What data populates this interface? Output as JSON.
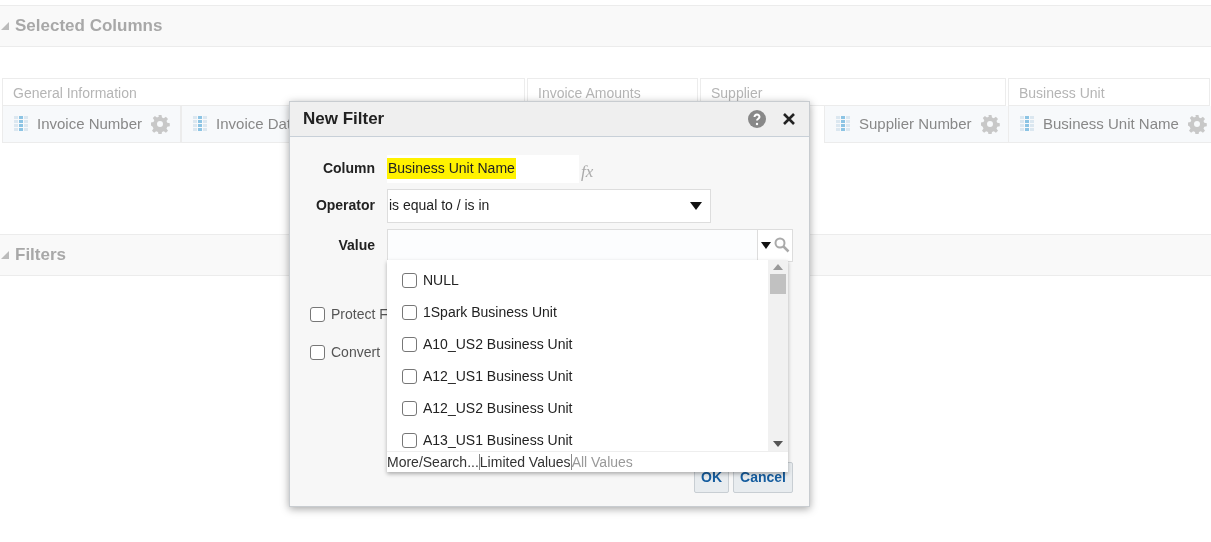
{
  "sections": [
    {
      "title": "Selected Columns",
      "expanded": true
    },
    {
      "title": "Filters",
      "expanded": true
    }
  ],
  "column_groups": [
    {
      "title": "General Information",
      "columns": [
        "Invoice Number",
        "Invoice Dat"
      ]
    },
    {
      "title": "Invoice Amounts"
    },
    {
      "title": "Supplier",
      "columns": [
        "Supplier Number"
      ]
    },
    {
      "title": "Business Unit",
      "columns": [
        "Business Unit Name"
      ]
    }
  ],
  "dialog": {
    "title": "New Filter",
    "column": {
      "label": "Column",
      "value": "Business Unit Name",
      "highlighted": true,
      "formula_button": "fx"
    },
    "operator": {
      "label": "Operator",
      "value": "is equal to / is in"
    },
    "value": {
      "label": "Value"
    },
    "options": [
      {
        "checked": false,
        "label": "Protect F"
      },
      {
        "checked": false,
        "label": "Convert"
      }
    ],
    "buttons": [
      "OK",
      "Cancel"
    ],
    "dropdown": {
      "items": [
        {
          "label": "NULL",
          "checked": false
        },
        {
          "label": "1Spark Business Unit",
          "checked": false
        },
        {
          "label": "A10_US2 Business Unit",
          "checked": false
        },
        {
          "label": "A12_US1 Business Unit",
          "checked": false
        },
        {
          "label": "A12_US2 Business Unit",
          "checked": false
        },
        {
          "label": "A13_US1 Business Unit",
          "checked": false
        }
      ],
      "links": [
        {
          "label": "More/Search...",
          "enabled": true
        },
        {
          "label": "Limited Values",
          "enabled": true
        },
        {
          "label": "All Values",
          "enabled": false
        }
      ]
    }
  }
}
